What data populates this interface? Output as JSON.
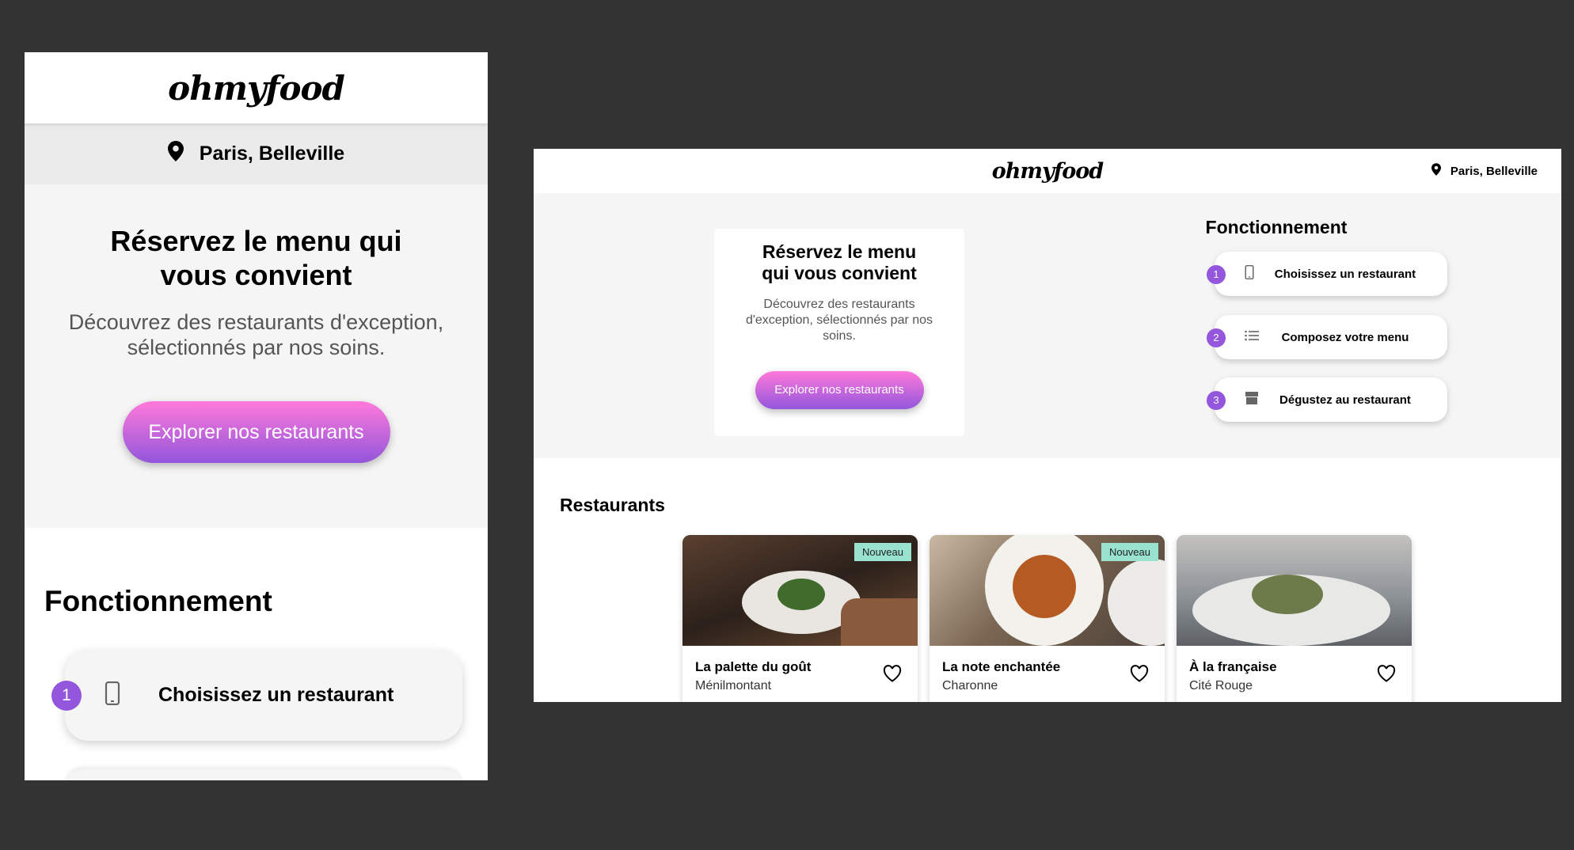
{
  "app": {
    "logo": "ohmyfood",
    "location": "Paris, Belleville",
    "accent_color": "#9356dc",
    "gradient": [
      "#ff79da",
      "#9356dc"
    ],
    "badge_color": "#99e2d0"
  },
  "hero": {
    "title": "Réservez le menu qui vous convient",
    "mobile_subtitle": "Découvrez des restaurants d'exception, sélectionnés par nos soins.",
    "desktop_subtitle": "Découvrez des restaurants d'exception, sélectionnés par nos soins.",
    "cta": "Explorer nos restaurants"
  },
  "how": {
    "title": "Fonctionnement",
    "steps": [
      {
        "number": "1",
        "icon": "mobile-phone-icon",
        "label": "Choisissez un restaurant"
      },
      {
        "number": "2",
        "icon": "list-icon",
        "label": "Composez votre menu"
      },
      {
        "number": "3",
        "icon": "store-icon",
        "label": "Dégustez au restaurant"
      }
    ]
  },
  "restaurants": {
    "title": "Restaurants",
    "items": [
      {
        "name": "La palette du goût",
        "area": "Ménilmontant",
        "badge": "Nouveau"
      },
      {
        "name": "La note enchantée",
        "area": "Charonne",
        "badge": "Nouveau"
      },
      {
        "name": "À la française",
        "area": "Cité Rouge",
        "badge": ""
      }
    ]
  }
}
